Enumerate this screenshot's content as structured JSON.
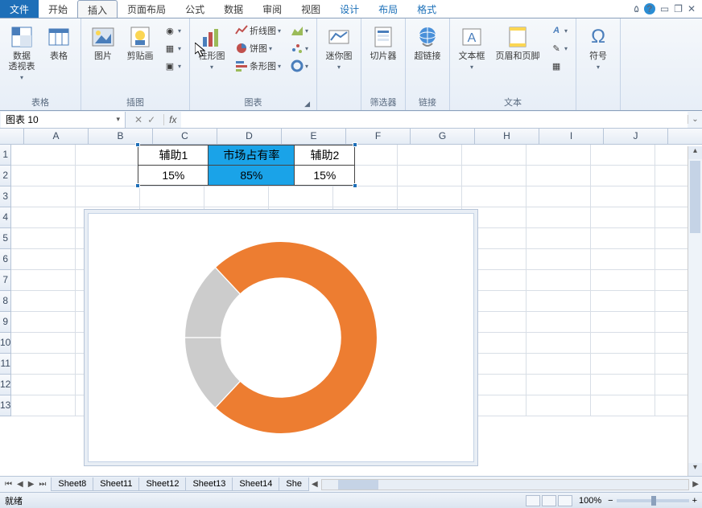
{
  "tabs": {
    "file": "文件",
    "home": "开始",
    "insert": "插入",
    "page_layout": "页面布局",
    "formulas": "公式",
    "data": "数据",
    "review": "审阅",
    "view": "视图",
    "design": "设计",
    "layout": "布局",
    "format": "格式"
  },
  "ribbon": {
    "tables": {
      "pivot": "数据\n透视表",
      "table": "表格",
      "label": "表格"
    },
    "illustrations": {
      "picture": "图片",
      "clipart": "剪贴画",
      "label": "插图"
    },
    "charts": {
      "column": "柱形图",
      "line": "折线图",
      "pie": "饼图",
      "bar": "条形图",
      "label": "图表"
    },
    "sparklines": {
      "btn": "迷你图",
      "label": ""
    },
    "filter": {
      "slicer": "切片器",
      "label": "筛选器"
    },
    "links": {
      "hyperlink": "超链接",
      "label": "链接"
    },
    "text": {
      "textbox": "文本框",
      "header_footer": "页眉和页脚",
      "label": "文本"
    },
    "symbols": {
      "symbol": "符号",
      "label": ""
    }
  },
  "name_box": "图表 10",
  "columns": [
    "A",
    "B",
    "C",
    "D",
    "E",
    "F",
    "G",
    "H",
    "I",
    "J"
  ],
  "row_count": 13,
  "table": {
    "headers": [
      "辅助1",
      "市场占有率",
      "辅助2"
    ],
    "values": [
      "15%",
      "85%",
      "15%"
    ]
  },
  "sheets": [
    "Sheet8",
    "Sheet11",
    "Sheet12",
    "Sheet13",
    "Sheet14",
    "She"
  ],
  "status_text": "就绪",
  "zoom": "100%",
  "chart_data": {
    "type": "pie",
    "subtype": "doughnut",
    "categories": [
      "辅助1",
      "市场占有率",
      "辅助2"
    ],
    "values": [
      15,
      85,
      15
    ],
    "colors": [
      "#cccccc",
      "#ed7d31",
      "#cccccc"
    ],
    "hole_ratio": 0.62,
    "start_angle": -90
  }
}
